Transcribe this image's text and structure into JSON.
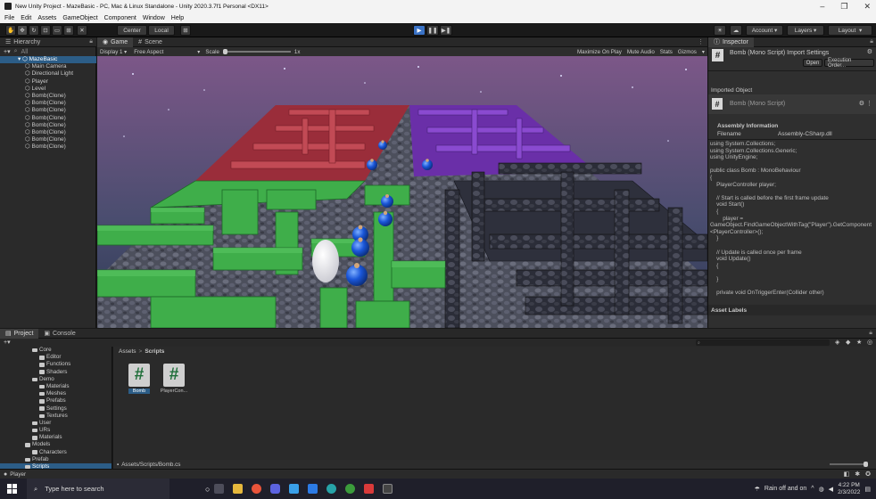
{
  "window": {
    "title": "New Unity Project - MazeBasic - PC, Mac & Linux Standalone - Unity 2020.3.7f1 Personal <DX11>"
  },
  "menu": [
    "File",
    "Edit",
    "Assets",
    "GameObject",
    "Component",
    "Window",
    "Help"
  ],
  "toolbar": {
    "center": "Center",
    "local": "Local",
    "account": "Account",
    "layers": "Layers",
    "layout": "Layout"
  },
  "hierarchy": {
    "tab": "Hierarchy",
    "search": "All",
    "items": [
      {
        "label": "MazeBasic",
        "indent": 0,
        "sel": true
      },
      {
        "label": "Main Camera",
        "indent": 1
      },
      {
        "label": "Directional Light",
        "indent": 1
      },
      {
        "label": "Player",
        "indent": 1
      },
      {
        "label": "Level",
        "indent": 1
      },
      {
        "label": "Bomb(Clone)",
        "indent": 1
      },
      {
        "label": "Bomb(Clone)",
        "indent": 1
      },
      {
        "label": "Bomb(Clone)",
        "indent": 1
      },
      {
        "label": "Bomb(Clone)",
        "indent": 1
      },
      {
        "label": "Bomb(Clone)",
        "indent": 1
      },
      {
        "label": "Bomb(Clone)",
        "indent": 1
      },
      {
        "label": "Bomb(Clone)",
        "indent": 1
      },
      {
        "label": "Bomb(Clone)",
        "indent": 1
      }
    ]
  },
  "game": {
    "tabs": [
      "Game",
      "Scene"
    ],
    "display": "Display 1",
    "aspect": "Free Aspect",
    "scale_label": "Scale",
    "scale_value": "1x",
    "options": [
      "Maximize On Play",
      "Mute Audio",
      "Stats",
      "Gizmos"
    ]
  },
  "inspector": {
    "tab": "Inspector",
    "title": "Bomb (Mono Script) Import Settings",
    "open_btn": "Open",
    "exec_btn": "Execution Order...",
    "imported_label": "Imported Object",
    "imported_name": "Bomb (Mono Script)",
    "assembly_header": "Assembly Information",
    "filename_label": "Filename",
    "filename_value": "Assembly-CSharp.dll",
    "code": "using System.Collections;\nusing System.Collections.Generic;\nusing UnityEngine;\n\npublic class Bomb : MonoBehaviour\n{\n    PlayerController player;\n\n    // Start is called before the first frame update\n    void Start()\n    {\n        player =\nGameObject.FindGameObjectWithTag(\"Player\").GetComponent\n<PlayerController>();\n    }\n\n    // Update is called once per frame\n    void Update()\n    {\n\n    }\n\n    private void OnTriggerEnter(Collider other)",
    "asset_labels": "Asset Labels"
  },
  "project": {
    "tabs": [
      "Project",
      "Console"
    ],
    "breadcrumb": [
      "Assets",
      "Scripts"
    ],
    "tree": [
      {
        "label": "Core",
        "indent": 1
      },
      {
        "label": "Editor",
        "indent": 2
      },
      {
        "label": "Functions",
        "indent": 2
      },
      {
        "label": "Shaders",
        "indent": 2
      },
      {
        "label": "Demo",
        "indent": 1
      },
      {
        "label": "Materials",
        "indent": 2
      },
      {
        "label": "Meshes",
        "indent": 2
      },
      {
        "label": "Prefabs",
        "indent": 2
      },
      {
        "label": "Settings",
        "indent": 2
      },
      {
        "label": "Textures",
        "indent": 2
      },
      {
        "label": "User",
        "indent": 1
      },
      {
        "label": "URs",
        "indent": 1
      },
      {
        "label": "Materials",
        "indent": 1
      },
      {
        "label": "Models",
        "indent": 0
      },
      {
        "label": "Characters",
        "indent": 1
      },
      {
        "label": "Prefab",
        "indent": 0
      },
      {
        "label": "Scripts",
        "indent": 0,
        "sel": true
      }
    ],
    "files": [
      "Bomb",
      "PlayerCon..."
    ],
    "footer_path": "Assets/Scripts/Bomb.cs"
  },
  "status": {
    "text": "Player"
  },
  "taskbar": {
    "search": "Type here to search",
    "weather": "Rain off and on",
    "time": "4:22 PM",
    "date": "2/3/2022"
  },
  "colors": {
    "play_active": "#3a72c5",
    "selection": "#2c5d87",
    "wall_green": "#3fae4a",
    "wall_red": "#b23a45",
    "wall_purple": "#7a3bb8",
    "bomb_blue": "#1a56d8"
  }
}
